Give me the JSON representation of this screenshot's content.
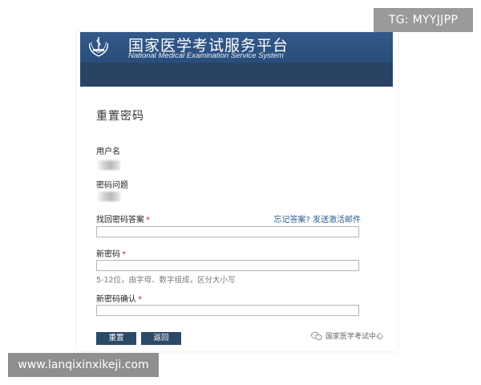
{
  "watermarks": {
    "top_right": "TG: MYYJJPP",
    "bottom_left": "www.lanqixinxikeji.com"
  },
  "header": {
    "title": "国家医学考试服务平台",
    "subtitle": "National Medical Examination Service System",
    "background_color": "#2a4a72"
  },
  "form": {
    "title": "重置密码",
    "username_label": "用户名",
    "question_label": "密码问题",
    "answer_label": "找回密码答案",
    "answer_required": "*",
    "forgot_link": "忘记答案? 发送激活邮件",
    "answer_value": "",
    "new_password_label": "新密码",
    "new_password_required": "*",
    "new_password_value": "",
    "password_hint": "5-12位，由字母、数字组成，区分大小写",
    "confirm_label": "新密码确认",
    "confirm_required": "*",
    "confirm_value": "",
    "reset_button": "重置",
    "back_button": "返回"
  },
  "footer": {
    "source_mark": "国家医学考试中心",
    "source_icon": "wechat-channel-icon"
  },
  "colors": {
    "button": "#2b4a68",
    "link": "#2b5f8c",
    "required": "#d0232b"
  }
}
